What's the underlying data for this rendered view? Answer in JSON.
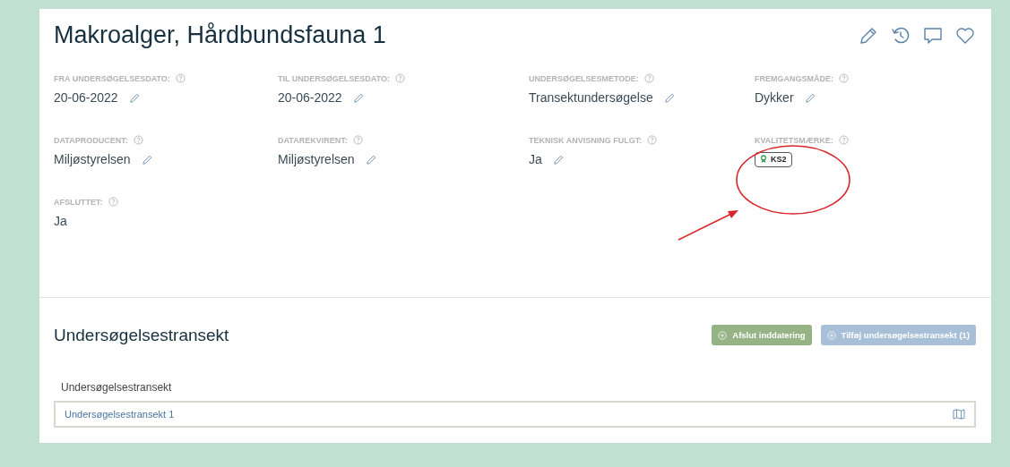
{
  "title": "Makroalger, Hårdbundsfauna 1",
  "fields": [
    {
      "label": "FRA UNDERSØGELSESDATO:",
      "value": "20-06-2022",
      "kind": "text",
      "editable": true
    },
    {
      "label": "TIL UNDERSØGELSESDATO:",
      "value": "20-06-2022",
      "kind": "text",
      "editable": true
    },
    {
      "label": "UNDERSØGELSESMETODE:",
      "value": "Transektundersøgelse",
      "kind": "text",
      "editable": true
    },
    {
      "label": "FREMGANGSMÅDE:",
      "value": "Dykker",
      "kind": "text",
      "editable": true
    },
    {
      "label": "DATAPRODUCENT:",
      "value": "Miljøstyrelsen",
      "kind": "text",
      "editable": true
    },
    {
      "label": "DATAREKVIRENT:",
      "value": "Miljøstyrelsen",
      "kind": "text",
      "editable": true
    },
    {
      "label": "TEKNISK ANVISNING FULGT:",
      "value": "Ja",
      "kind": "text",
      "editable": true
    },
    {
      "label": "KVALITETSMÆRKE:",
      "value": "KS2",
      "kind": "badge",
      "editable": false
    },
    {
      "label": "AFSLUTTET:",
      "value": "Ja",
      "kind": "text",
      "editable": false
    }
  ],
  "section": {
    "title": "Undersøgelsestransekt",
    "buttons": [
      {
        "label": "Afslut inddatering",
        "kind": "success"
      },
      {
        "label": "Tilføj undersøgelsestransekt (1)",
        "kind": "primary"
      }
    ],
    "table_header": "Undersøgelsestransekt",
    "rows": [
      "Undersøgelsestransekt 1"
    ]
  }
}
